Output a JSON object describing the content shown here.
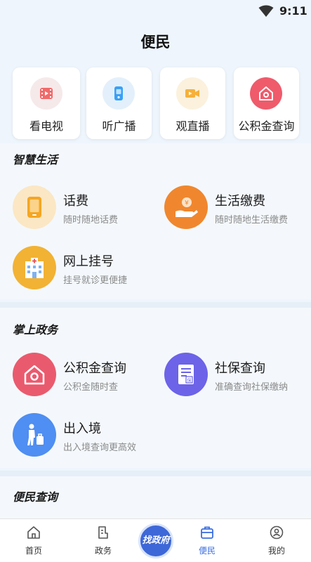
{
  "status_bar": {
    "time": "9:11"
  },
  "page_title": "便民",
  "quick_actions": [
    {
      "label": "看电视",
      "icon": "tv-video-icon",
      "color": "#f06a6a"
    },
    {
      "label": "听广播",
      "icon": "radio-icon",
      "color": "#3aa0f5"
    },
    {
      "label": "观直播",
      "icon": "live-camera-icon",
      "color": "#f5b13a"
    },
    {
      "label": "公积金查询",
      "icon": "housing-fund-icon",
      "color": "#ef5b6b"
    }
  ],
  "sections": [
    {
      "title": "智慧生活",
      "items": [
        {
          "name": "话费",
          "desc": "随时随地话费",
          "icon": "phone-icon",
          "color": "#f5a623"
        },
        {
          "name": "生活缴费",
          "desc": "随时随地生活缴费",
          "icon": "payment-hand-icon",
          "color": "#f0872e"
        },
        {
          "name": "网上挂号",
          "desc": "挂号就诊更便捷",
          "icon": "hospital-icon",
          "color": "#f2b233"
        }
      ]
    },
    {
      "title": "掌上政务",
      "items": [
        {
          "name": "公积金查询",
          "desc": "公积金随时查",
          "icon": "housing-fund-icon",
          "color": "#ea5a6e"
        },
        {
          "name": "社保查询",
          "desc": "准确查询社保缴纳",
          "icon": "social-security-icon",
          "color": "#6c63e8"
        },
        {
          "name": "出入境",
          "desc": "出入境查询更高效",
          "icon": "traveler-icon",
          "color": "#4f8ef2"
        }
      ]
    },
    {
      "title": "便民查询",
      "items": []
    }
  ],
  "tab_bar": {
    "tabs": [
      {
        "label": "首页",
        "icon": "home-icon"
      },
      {
        "label": "政务",
        "icon": "document-icon"
      },
      {
        "label": "便民",
        "icon": "briefcase-icon"
      },
      {
        "label": "我的",
        "icon": "profile-icon"
      }
    ],
    "center_button": "找政府",
    "active": "便民",
    "active_color": "#3b6fe0"
  }
}
